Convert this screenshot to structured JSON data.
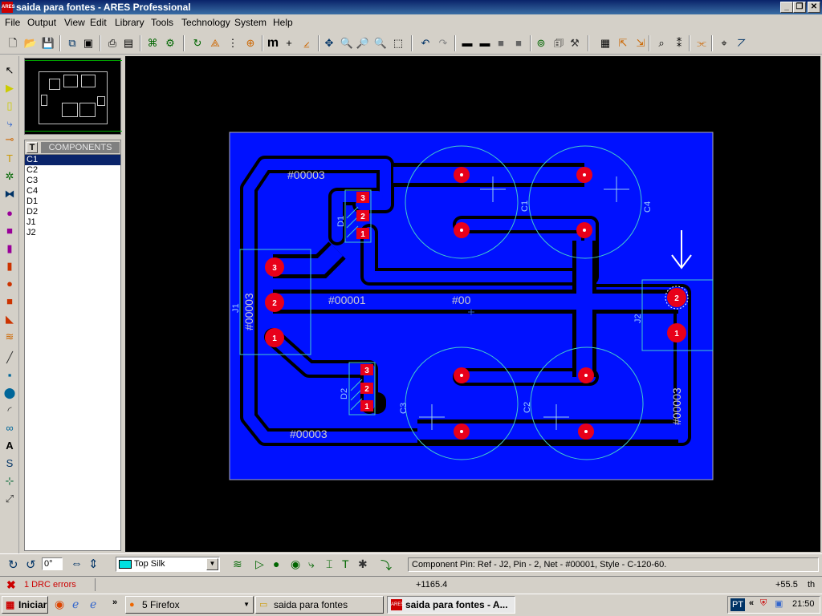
{
  "window": {
    "title": "saida para fontes - ARES Professional",
    "icon_text": "ARES"
  },
  "menu": [
    "File",
    "Output",
    "View",
    "Edit",
    "Library",
    "Tools",
    "Technology",
    "System",
    "Help"
  ],
  "components": {
    "tab": "T",
    "header": "COMPONENTS",
    "items": [
      "C1",
      "C2",
      "C3",
      "C4",
      "D1",
      "D2",
      "J1",
      "J2"
    ],
    "selected": "C1"
  },
  "pcb": {
    "board_color": "#0011ff",
    "copper_color": "#0011ff",
    "pad_color": "#e8001a",
    "net_labels": [
      "#00003",
      "#00001",
      "#00",
      "#00003",
      "#00003",
      "#00003"
    ],
    "ref_labels": [
      "D1",
      "D2",
      "J1",
      "J2",
      "C1",
      "C2",
      "C3",
      "C4"
    ],
    "pin_numbers": [
      "3",
      "2",
      "1",
      "3",
      "2",
      "1",
      "3",
      "2",
      "1",
      "2",
      "1"
    ]
  },
  "bottom": {
    "rotation_value": "0°",
    "layer": "Top Silk",
    "status_message": "Component Pin: Ref - J2, Pin - 2, Net - #00001, Style - C-120-60."
  },
  "status": {
    "drc": "1 DRC errors",
    "x_coord": "+1165.4",
    "y_coord": "+55.5",
    "unit": "th"
  },
  "taskbar": {
    "start": "Iniciar",
    "firefox": "5 Firefox",
    "folder": "saida para fontes",
    "ares": "saida para fontes - A...",
    "lang": "PT",
    "clock": "21:50"
  }
}
